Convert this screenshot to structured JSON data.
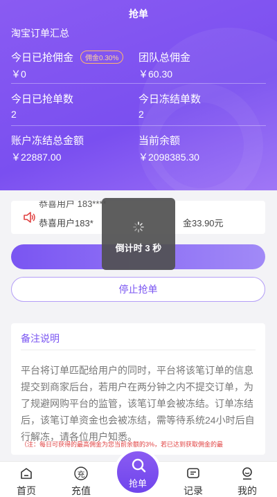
{
  "header": {
    "title": "抢单",
    "summary_title": "淘宝订单汇总",
    "stats": {
      "today_commission_label": "今日已抢佣金",
      "commission_rate": "佣金0.30%",
      "today_commission_value": "￥0",
      "team_commission_label": "团队总佣金",
      "team_commission_value": "￥60.30",
      "today_orders_label": "今日已抢单数",
      "today_orders_value": "2",
      "today_frozen_label": "今日冻结单数",
      "today_frozen_value": "2",
      "frozen_total_label": "账户冻结总金额",
      "frozen_total_value": "￥22887.00",
      "balance_label": "当前余额",
      "balance_value": "￥2098385.30"
    }
  },
  "marquee": {
    "line_top": "恭喜用户 183****                              ",
    "line_left": "恭喜用户183*",
    "line_right": "金33.90元"
  },
  "toast": {
    "text": "倒计时 3 秒"
  },
  "buttons": {
    "stop": "停止抢单"
  },
  "notes": {
    "title": "备注说明",
    "body": "平台将订单匹配给用户的同时，平台将该笔订单的信息提交到商家后台，若用户在两分钟之内不提交订单，为了规避网购平台的监管，该笔订单会被冻结。订单冻结后，该笔订单资金也会被冻结，需等待系统24小时后自行解冻，请各位用户知悉。",
    "tip": "（注：每日可获得的最高佣金为您当前余额的3%，若已达到获取佣金的最"
  },
  "nav": {
    "home": "首页",
    "recharge": "充值",
    "recharge_icon_char": "充",
    "grab": "抢单",
    "records": "记录",
    "mine": "我的"
  },
  "colors": {
    "primary": "#7a55f2",
    "badge": "#ffb86b",
    "tip": "#e04040"
  }
}
